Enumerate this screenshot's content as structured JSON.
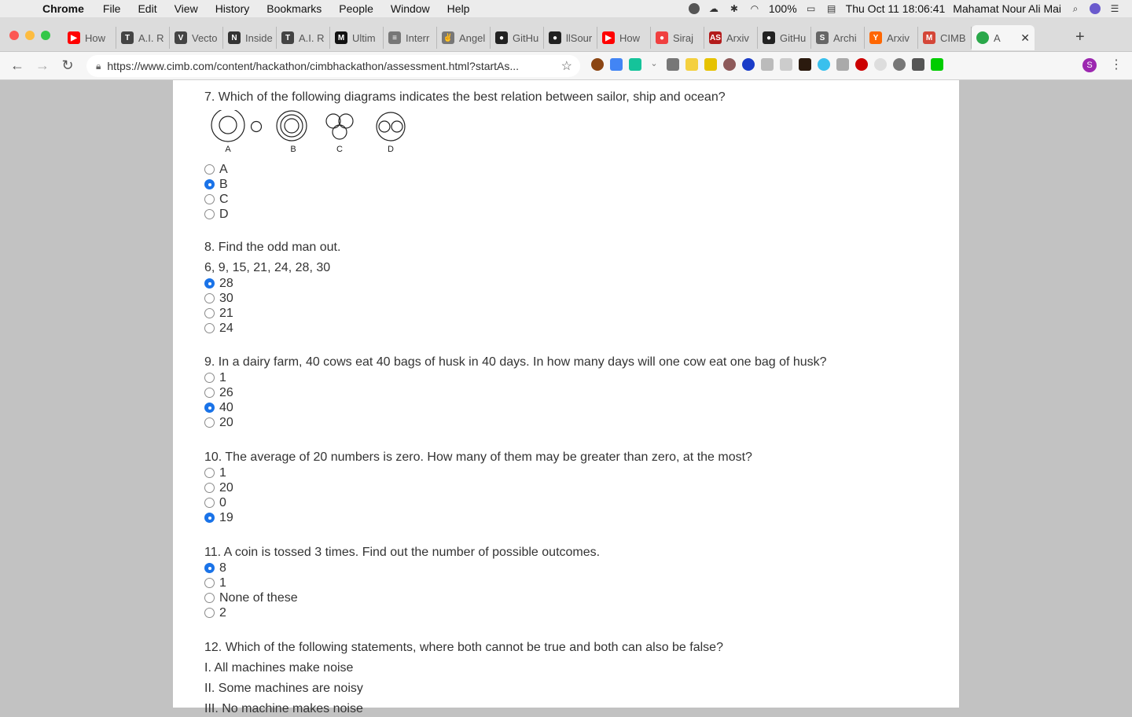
{
  "menubar": {
    "app": "Chrome",
    "items": [
      "File",
      "Edit",
      "View",
      "History",
      "Bookmarks",
      "People",
      "Window",
      "Help"
    ],
    "battery": "100%",
    "datetime": "Thu Oct 11  18:06:41",
    "user": "Mahamat Nour Ali Mai"
  },
  "tabs": [
    {
      "label": "How",
      "color": "#ff0000",
      "glyph": "▶"
    },
    {
      "label": "A.I. R",
      "color": "#444444",
      "glyph": "T"
    },
    {
      "label": "Vecto",
      "color": "#444444",
      "glyph": "V"
    },
    {
      "label": "Inside",
      "color": "#333333",
      "glyph": "N"
    },
    {
      "label": "A.I. R",
      "color": "#444444",
      "glyph": "T"
    },
    {
      "label": "Ultim",
      "color": "#111111",
      "glyph": "M"
    },
    {
      "label": "Interr",
      "color": "#777777",
      "glyph": "≡"
    },
    {
      "label": "Angel",
      "color": "#777777",
      "glyph": "✌"
    },
    {
      "label": "GitHu",
      "color": "#222222",
      "glyph": "●"
    },
    {
      "label": "llSour",
      "color": "#222222",
      "glyph": "●"
    },
    {
      "label": "How",
      "color": "#ff0000",
      "glyph": "▶"
    },
    {
      "label": "Siraj",
      "color": "#f04040",
      "glyph": "●"
    },
    {
      "label": "Arxiv",
      "color": "#b31b1b",
      "glyph": "AS"
    },
    {
      "label": "GitHu",
      "color": "#222222",
      "glyph": "●"
    },
    {
      "label": "Archi",
      "color": "#666666",
      "glyph": "S"
    },
    {
      "label": "Arxiv",
      "color": "#ff6600",
      "glyph": "Y"
    },
    {
      "label": "CIMB",
      "color": "#d44638",
      "glyph": "M"
    }
  ],
  "active_tab": {
    "label": "A",
    "close": "✕"
  },
  "address": {
    "url": "https://www.cimb.com/content/hackathon/cimbhackathon/assessment.html?startAs..."
  },
  "profile_initial": "S",
  "questions": {
    "q7": {
      "text": "7. Which of the following diagrams indicates the best relation between sailor, ship and ocean?",
      "diagram_labels": [
        "A",
        "B",
        "C",
        "D"
      ],
      "options": [
        "A",
        "B",
        "C",
        "D"
      ],
      "selected": 1
    },
    "q8": {
      "text": "8. Find the odd man out.",
      "sub": "6, 9, 15, 21, 24, 28, 30",
      "options": [
        "28",
        "30",
        "21",
        "24"
      ],
      "selected": 0
    },
    "q9": {
      "text": "9. In a dairy farm, 40 cows eat 40 bags of husk in 40 days. In how many days will one cow eat one bag of husk?",
      "options": [
        "1",
        "26",
        "40",
        "20"
      ],
      "selected": 2
    },
    "q10": {
      "text": "10. The average of 20 numbers is zero. How many of them may be greater than zero, at the most?",
      "options": [
        "1",
        "20",
        "0",
        "19"
      ],
      "selected": 3
    },
    "q11": {
      "text": "11. A coin is tossed 3 times. Find out the number of possible outcomes.",
      "options": [
        "8",
        "1",
        "None of these",
        "2"
      ],
      "selected": 0
    },
    "q12": {
      "text": "12. Which of the following statements, where both cannot be true and both can also be false?",
      "statements": [
        "I. All machines make noise",
        "II. Some machines are noisy",
        "III. No machine makes noise"
      ]
    }
  }
}
